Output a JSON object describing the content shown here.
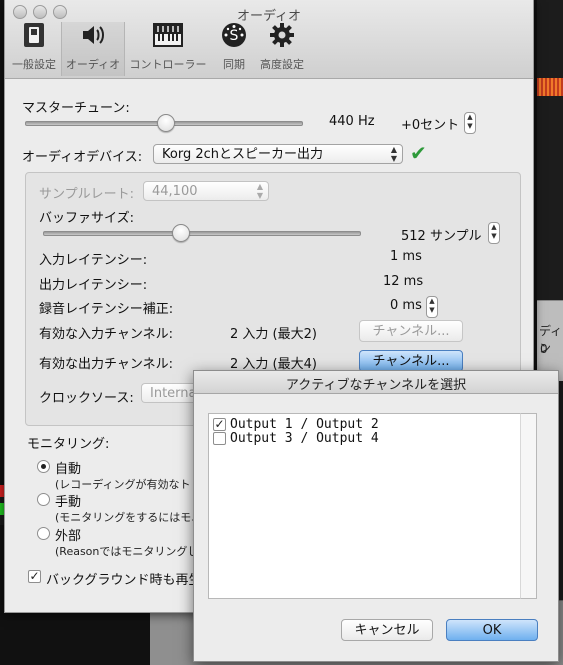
{
  "window": {
    "title": "オーディオ",
    "toolbar": [
      {
        "label": "一般設定",
        "icon": "switch-icon"
      },
      {
        "label": "オーディオ",
        "icon": "speaker-icon",
        "selected": true
      },
      {
        "label": "コントローラー",
        "icon": "keyboard-icon"
      },
      {
        "label": "同期",
        "icon": "sync-icon"
      },
      {
        "label": "高度設定",
        "icon": "gear-icon"
      }
    ]
  },
  "master_tune": {
    "label": "マスターチューン:",
    "hz": "440 Hz",
    "cents": "+0セント",
    "level": 0.5
  },
  "audio_device": {
    "label": "オーディオデバイス:",
    "value": "Korg 2chとスピーカー出力",
    "status_icon": "checkmark-icon",
    "status_color": "#2e9a3a"
  },
  "settings": {
    "sample_rate_label": "サンプルレート:",
    "sample_rate_value": "44,100",
    "buffer_label": "バッファサイズ:",
    "buffer_value": "512 サンプル",
    "buffer_level": 0.5,
    "input_latency_label": "入力レイテンシー:",
    "input_latency_value": "1 ms",
    "output_latency_label": "出力レイテンシー:",
    "output_latency_value": "12 ms",
    "rec_comp_label": "録音レイテンシー補正:",
    "rec_comp_value": "0 ms",
    "in_channels_label": "有効な入力チャンネル:",
    "in_channels_value": "2 入力 (最大2)",
    "in_channels_button": "チャンネル...",
    "out_channels_label": "有効な出力チャンネル:",
    "out_channels_value": "2 入力 (最大4)",
    "out_channels_button": "チャンネル...",
    "clock_label": "クロックソース:",
    "clock_value": "Interna"
  },
  "monitoring": {
    "label": "モニタリング:",
    "options": [
      {
        "label": "自動",
        "desc": "(レコーディングが有効なト",
        "selected": true
      },
      {
        "label": "手動",
        "desc": "(モニタリングをするにはモニ",
        "selected": false
      },
      {
        "label": "外部",
        "desc": "(Reasonではモニタリングし",
        "selected": false
      }
    ],
    "background_label": "バックグラウンド時も再生",
    "background_checked": true
  },
  "dialog": {
    "title": "アクティブなチャンネルを選択",
    "channels": [
      {
        "label": "Output 1 / Output 2",
        "checked": true
      },
      {
        "label": "Output 3 / Output 4",
        "checked": false
      }
    ],
    "cancel": "キャンセル",
    "ok": "OK"
  },
  "background_app": {
    "panel_text_1": "ディン",
    "panel_text_2": "0"
  }
}
